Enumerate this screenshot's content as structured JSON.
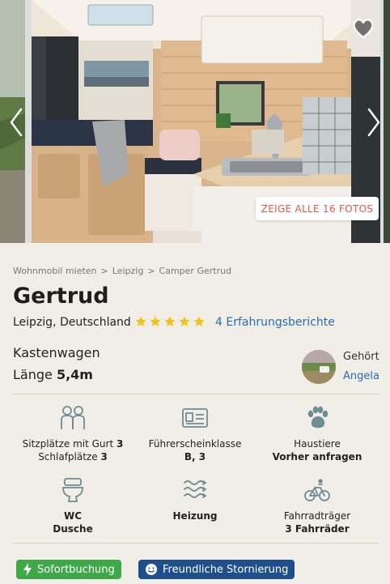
{
  "gallery": {
    "all_photos_label": "ZEIGE ALLE 16 FOTOS"
  },
  "breadcrumb": [
    "Wohnmobil mieten",
    ">",
    "Leipzig",
    ">",
    "Camper Gertrud"
  ],
  "listing": {
    "title": "Gertrud",
    "location": "Leipzig, Deutschland",
    "rating": 5,
    "reviews": "4 Erfahrungsberichte",
    "vehicle_type": "Kastenwagen",
    "length_label": "Länge",
    "length_value": "5,4m"
  },
  "owner": {
    "label": "Gehört",
    "name": "Angela"
  },
  "features": [
    {
      "icon": "seats-icon",
      "line1_label": "Sitzplätze mit Gurt",
      "line1_value": "3",
      "line2_label": "Schlafplätze",
      "line2_value": "3"
    },
    {
      "icon": "license-icon",
      "line1": "Führerscheinklasse",
      "line2": "B, 3"
    },
    {
      "icon": "paw-icon",
      "line1": "Haustiere",
      "line2": "Vorher anfragen"
    },
    {
      "icon": "toilet-icon",
      "line1": "WC",
      "line2": "Dusche"
    },
    {
      "icon": "heating-icon",
      "line1": "Heizung"
    },
    {
      "icon": "bicycle-icon",
      "line1": "Fahrradträger",
      "line2": "3 Fahrräder"
    }
  ],
  "badges": {
    "instant": "Sofortbuchung",
    "cancellation": "Freundliche Stornierung"
  },
  "colors": {
    "link": "#2a6cae",
    "accent_red": "#e0584a",
    "star": "#f2c21b",
    "icon_teal": "#6e8c94",
    "badge_green": "#3fa848",
    "badge_blue": "#1e4f8c",
    "background": "#f1eee8"
  }
}
